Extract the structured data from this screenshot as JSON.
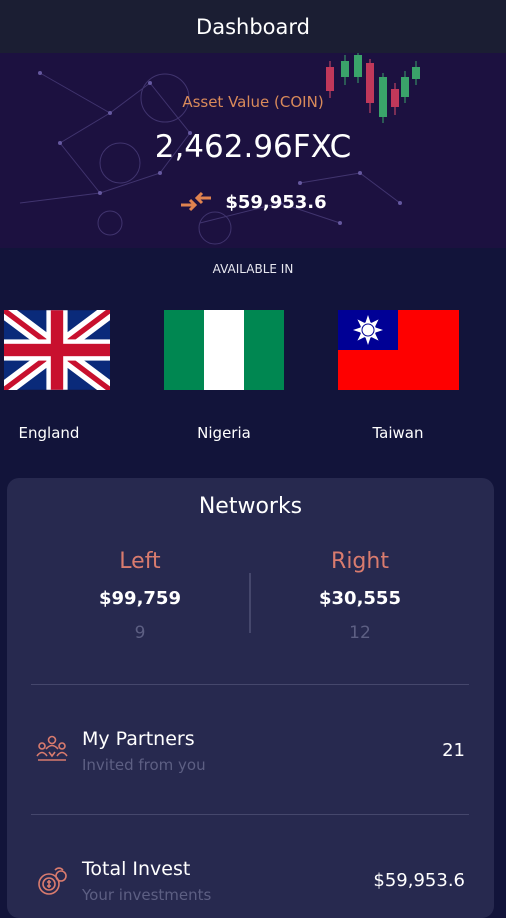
{
  "header": {
    "title": "Dashboard"
  },
  "hero": {
    "asset_label": "Asset Value (COIN)",
    "asset_value": "2,462.96FXC",
    "usd_value": "$59,953.6",
    "exchange_icon": "exchange-arrows-icon"
  },
  "available": {
    "heading": "AVAILABLE IN",
    "countries": [
      {
        "name": "England",
        "flag": "uk-flag-icon"
      },
      {
        "name": "Nigeria",
        "flag": "nigeria-flag-icon"
      },
      {
        "name": "Taiwan",
        "flag": "taiwan-flag-icon"
      }
    ]
  },
  "networks": {
    "title": "Networks",
    "left": {
      "label": "Left",
      "amount": "$99,759",
      "count": "9"
    },
    "right": {
      "label": "Right",
      "amount": "$30,555",
      "count": "12"
    }
  },
  "stats": [
    {
      "title": "My Partners",
      "subtitle": "Invited from you",
      "value": "21",
      "icon": "partners-icon"
    },
    {
      "title": "Total Invest",
      "subtitle": "Your investments",
      "value": "$59,953.6",
      "icon": "invest-icon"
    }
  ],
  "colors": {
    "accent": "#d97b6e",
    "asset_label": "#d98a5a",
    "card": "#27294f",
    "background": "#12143a"
  }
}
